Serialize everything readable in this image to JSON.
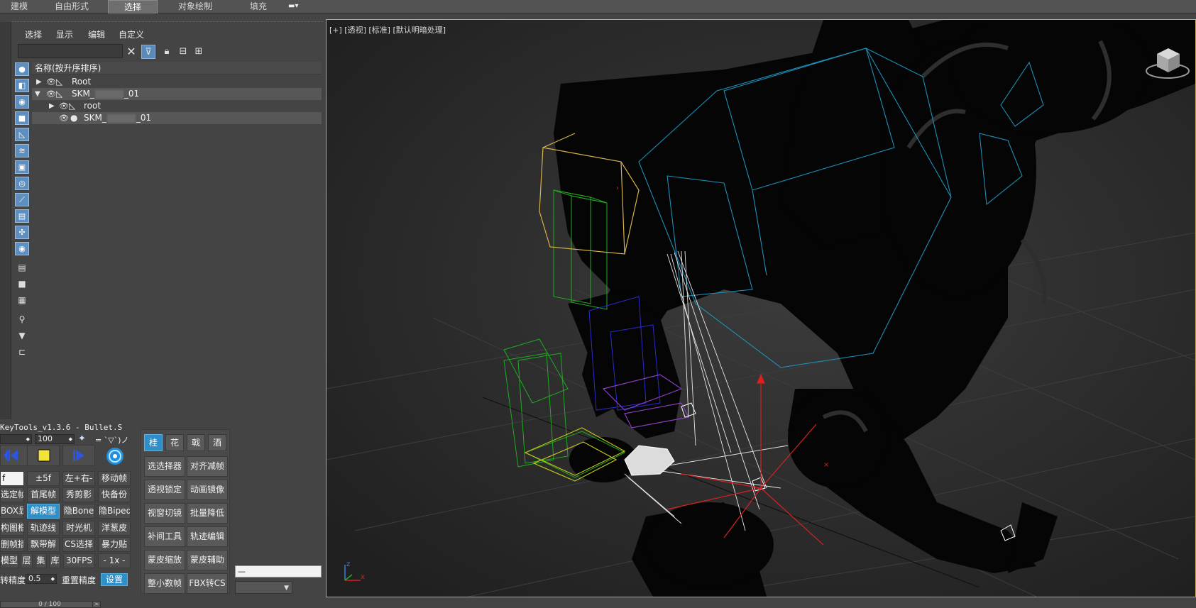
{
  "ribbon": {
    "tabs": [
      {
        "label": "建模"
      },
      {
        "label": "自由形式"
      },
      {
        "label": "选择"
      },
      {
        "label": "对象绘制"
      },
      {
        "label": "填充"
      }
    ],
    "active_tab": "选择",
    "menu_glyph": "▾"
  },
  "scene_explorer": {
    "menu": [
      "选择",
      "显示",
      "编辑",
      "自定义"
    ],
    "search": {
      "value": "",
      "placeholder": ""
    },
    "column_header": "名称(按升序排序)",
    "tree": [
      {
        "name": "Root",
        "name_tail": "",
        "expanded": false,
        "icon": "bone-icon"
      },
      {
        "name": "SKM_",
        "name_tail": "_01",
        "expanded": true,
        "icon": "bone-icon"
      },
      {
        "name": "root",
        "name_tail": "",
        "expanded": false,
        "icon": "bone-icon"
      },
      {
        "name": "SKM_",
        "name_tail": "_01",
        "expanded": false,
        "icon": "sphere-icon"
      }
    ]
  },
  "keytools": {
    "title": "KeyTools_v1.3.6 - Bullet.S",
    "spin1": "",
    "spin2": "100",
    "spin_suffix": "= `▽`)ノ",
    "field_f": "f",
    "buttons_row1": [
      "±5f",
      "左+右-",
      "移动帧"
    ],
    "buttons_row2": [
      "选定帧",
      "首尾帧",
      "秀剪影",
      "快备份"
    ],
    "buttons_row3": [
      "BOX显",
      "解模型",
      "隐Bone",
      "隐Biped"
    ],
    "buttons_row4": [
      "构图框",
      "轨迹线",
      "时光机",
      "洋葱皮"
    ],
    "buttons_row5": [
      "删帧插",
      "飘带解",
      "CS选择",
      "暴力贴"
    ],
    "buttons_row6": [
      "模型",
      "层",
      "集",
      "库",
      "30FPS",
      "- 1x -"
    ],
    "precision_label": "转精度",
    "precision_value": "0.5",
    "reset_precision": "重置精度",
    "settings": "设置",
    "highlight_color": "#2f8fc8"
  },
  "tool_panel": {
    "tabs": [
      "桂",
      "花",
      "戟",
      "酒"
    ],
    "buttons": [
      [
        "选选择器",
        "对齐减帧"
      ],
      [
        "透视锁定",
        "动画镜像"
      ],
      [
        "视窗切镜",
        "批量降低"
      ],
      [
        "补间工具",
        "轨迹编辑"
      ],
      [
        "蒙皮缩放",
        "蒙皮辅助"
      ],
      [
        "整小数帧",
        "FBX转CS"
      ]
    ]
  },
  "bottom": {
    "field_value": "—",
    "time_slider": "0 / 100",
    "arrow": ">"
  },
  "viewport": {
    "label": "[+] [透视] [标准] [默认明暗处理]",
    "axis_x": "x",
    "axis_z": "z",
    "frame_color": "#c9a84a"
  }
}
